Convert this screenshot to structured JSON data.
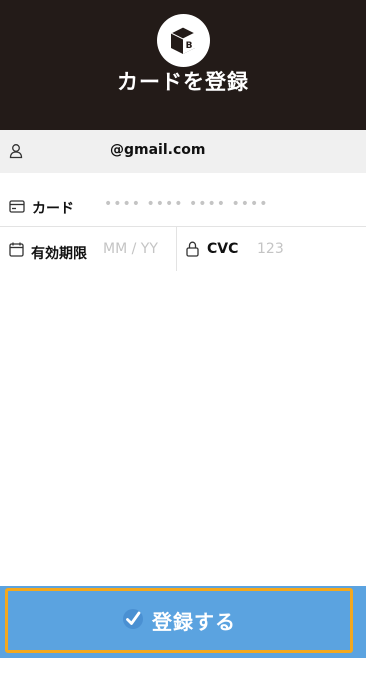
{
  "header": {
    "title": "カードを登録",
    "logo_letter": "B",
    "background": "#231b18"
  },
  "account": {
    "email": "@gmail.com",
    "icon": "user-icon"
  },
  "card": {
    "label": "カード",
    "placeholder": "•••• •••• •••• ••••",
    "icon": "credit-card-icon"
  },
  "expiry": {
    "label": "有効期限",
    "placeholder": "MM / YY",
    "icon": "calendar-icon"
  },
  "cvc": {
    "label": "CVC",
    "placeholder": "123",
    "icon": "lock-icon"
  },
  "submit": {
    "label": "登録する",
    "icon": "checkmark-icon",
    "background": "#5ba3e0",
    "focus_outline": "#f4a81d"
  }
}
